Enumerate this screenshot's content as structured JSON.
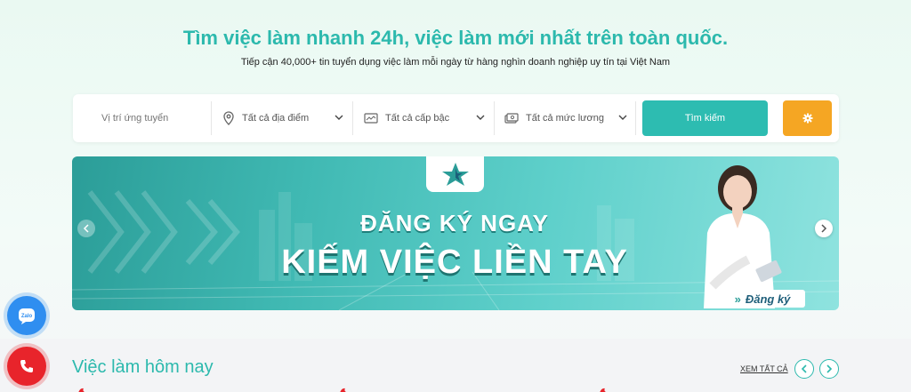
{
  "hero": {
    "title": "Tìm việc làm nhanh 24h, việc làm mới nhất trên toàn quốc.",
    "subtitle": "Tiếp cận 40,000+ tin tuyển dụng việc làm mỗi ngày từ hàng nghìn doanh nghiệp uy tín tại Việt Nam"
  },
  "search": {
    "position_placeholder": "Vị trí ứng tuyển",
    "location_label": "Tất cả địa điểm",
    "level_label": "Tất cả cấp bậc",
    "salary_label": "Tất cả mức lương",
    "search_button": "Tìm kiếm",
    "filter_icon": "gear-icon"
  },
  "banner": {
    "line1": "ĐĂNG KÝ NGAY",
    "line2": "KIẾM VIỆC LIỀN TAY",
    "cta": "Đăng ký"
  },
  "section": {
    "title": "Việc làm hôm nay",
    "see_all": "XEM TẤT CẢ"
  },
  "floating": {
    "zalo_label": "Zalo",
    "phone_icon": "phone-icon"
  },
  "colors": {
    "accent": "#2cb9ad",
    "search_button": "#2dbcb1",
    "filter_button": "#f5a623",
    "zalo": "#2f8ef0",
    "phone": "#e8242b"
  }
}
